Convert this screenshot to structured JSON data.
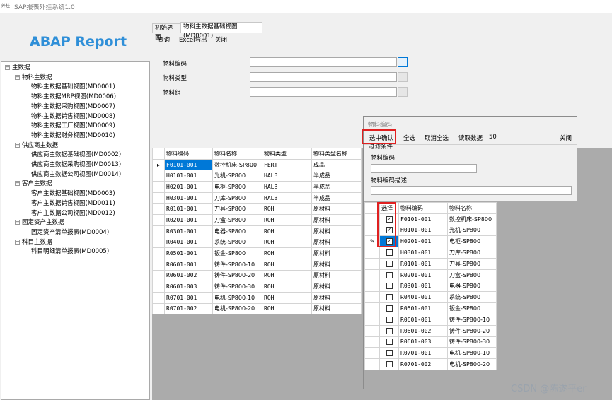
{
  "window": {
    "icon_text": "外挂",
    "title": "SAP报表外挂系统1.0"
  },
  "logo": "ABAP Report",
  "tree": [
    {
      "label": "主数据",
      "sign": "−"
    },
    {
      "label": "物料主数据",
      "sign": "−"
    },
    {
      "label": "物料主数据基础视图(MD0001)"
    },
    {
      "label": "物料主数据MRP视图(MD0006)"
    },
    {
      "label": "物料主数据采购视图(MD0007)"
    },
    {
      "label": "物料主数据销售视图(MD0008)"
    },
    {
      "label": "物料主数据工厂视图(MD0009)"
    },
    {
      "label": "物料主数据财务视图(MD0010)"
    },
    {
      "label": "供应商主数据",
      "sign": "−"
    },
    {
      "label": "供应商主数据基础视图(MD0002)"
    },
    {
      "label": "供应商主数据采购视图(MD0013)"
    },
    {
      "label": "供应商主数据公司视图(MD0014)"
    },
    {
      "label": "客户主数据",
      "sign": "−"
    },
    {
      "label": "客户主数据基础视图(MD0003)"
    },
    {
      "label": "客户主数据销售视图(MD0011)"
    },
    {
      "label": "客户主数据公司视图(MD0012)"
    },
    {
      "label": "固定资产主数据",
      "sign": "−"
    },
    {
      "label": "固定资产清单报表(MD0004)"
    },
    {
      "label": "科目主数据",
      "sign": "−"
    },
    {
      "label": "科目明细清单报表(MD0005)"
    }
  ],
  "tabs": [
    {
      "label": "初始界面"
    },
    {
      "label": "物料主数据基础视图(MD0001)"
    }
  ],
  "menu": {
    "query": "查询",
    "excel": "Excel导出",
    "close": "关闭"
  },
  "form": {
    "material_code": "物料编码",
    "material_type": "物料类型",
    "material_group": "物料组"
  },
  "grid": {
    "headers": [
      "物料编码",
      "物料名称",
      "物料类型",
      "物料类型名称"
    ],
    "row_marker": "▸",
    "rows": [
      [
        "F0101-001",
        "数控机床-SP800",
        "FERT",
        "成品"
      ],
      [
        "H0101-001",
        "光机-SP800",
        "HALB",
        "半成品"
      ],
      [
        "H0201-001",
        "电柜-SP800",
        "HALB",
        "半成品"
      ],
      [
        "H0301-001",
        "刀库-SP800",
        "HALB",
        "半成品"
      ],
      [
        "R0101-001",
        "刀具-SP800",
        "ROH",
        "原材料"
      ],
      [
        "R0201-001",
        "刀盒-SP800",
        "ROH",
        "原材料"
      ],
      [
        "R0301-001",
        "电器-SP800",
        "ROH",
        "原材料"
      ],
      [
        "R0401-001",
        "系统-SP800",
        "ROH",
        "原材料"
      ],
      [
        "R0501-001",
        "钣金-SP800",
        "ROH",
        "原材料"
      ],
      [
        "R0601-001",
        "铸件-SP800-10",
        "ROH",
        "原材料"
      ],
      [
        "R0601-002",
        "铸件-SP800-20",
        "ROH",
        "原材料"
      ],
      [
        "R0601-003",
        "铸件-SP800-30",
        "ROH",
        "原材料"
      ],
      [
        "R0701-001",
        "电机-SP800-10",
        "ROH",
        "原材料"
      ],
      [
        "R0701-002",
        "电机-SP800-20",
        "ROH",
        "原材料"
      ]
    ]
  },
  "popup": {
    "title": "物料编码",
    "confirm": "选中确认",
    "select_all": "全选",
    "deselect_all": "取消全选",
    "read_data": "读取数据",
    "read_count": "50",
    "close": "关闭",
    "filter_group": "过滤条件",
    "filter_code_label": "物料编码",
    "filter_desc_label": "物料编码描述",
    "headers": [
      "选择",
      "物料编码",
      "物料名称"
    ],
    "edit_marker": "✎",
    "rows": [
      {
        "checked": true,
        "code": "F0101-001",
        "name": "数控机床-SP800"
      },
      {
        "checked": true,
        "code": "H0101-001",
        "name": "光机-SP800"
      },
      {
        "checked": true,
        "code": "H0201-001",
        "name": "电柜-SP800"
      },
      {
        "checked": false,
        "code": "H0301-001",
        "name": "刀库-SP800"
      },
      {
        "checked": false,
        "code": "R0101-001",
        "name": "刀具-SP800"
      },
      {
        "checked": false,
        "code": "R0201-001",
        "name": "刀盒-SP800"
      },
      {
        "checked": false,
        "code": "R0301-001",
        "name": "电器-SP800"
      },
      {
        "checked": false,
        "code": "R0401-001",
        "name": "系统-SP800"
      },
      {
        "checked": false,
        "code": "R0501-001",
        "name": "钣金-SP800"
      },
      {
        "checked": false,
        "code": "R0601-001",
        "name": "铸件-SP800-10"
      },
      {
        "checked": false,
        "code": "R0601-002",
        "name": "铸件-SP800-20"
      },
      {
        "checked": false,
        "code": "R0601-003",
        "name": "铸件-SP800-30"
      },
      {
        "checked": false,
        "code": "R0701-001",
        "name": "电机-SP800-10"
      },
      {
        "checked": false,
        "code": "R0701-002",
        "name": "电机-SP800-20"
      }
    ],
    "check_glyph": "✓"
  },
  "watermark": "CSDN @陈遂平er",
  "colors": {
    "logo": "#2f8fd8",
    "selection": "#0078d7",
    "highlight_box": "#e02020"
  }
}
